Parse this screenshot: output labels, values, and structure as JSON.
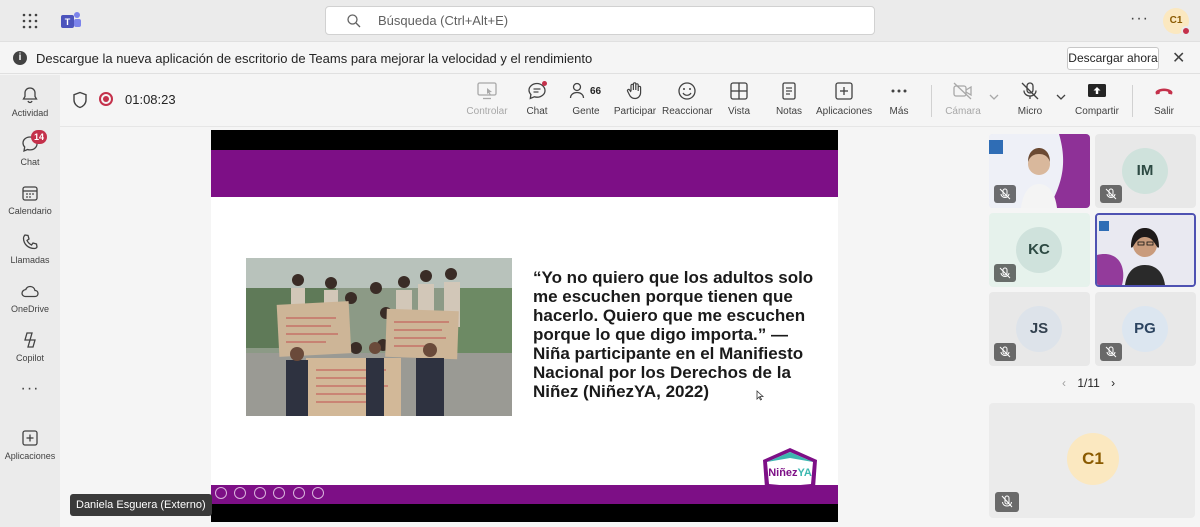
{
  "topbar": {
    "search_placeholder": "Búsqueda (Ctrl+Alt+E)",
    "avatar_initials": "C1"
  },
  "banner": {
    "message": "Descargue la nueva aplicación de escritorio de Teams para mejorar la velocidad y el rendimiento",
    "download_label": "Descargar ahora"
  },
  "rail": {
    "items": [
      {
        "label": "Actividad",
        "icon": "bell-icon"
      },
      {
        "label": "Chat",
        "icon": "chat-icon",
        "badge": "14"
      },
      {
        "label": "Calendario",
        "icon": "calendar-icon"
      },
      {
        "label": "Llamadas",
        "icon": "phone-icon"
      },
      {
        "label": "OneDrive",
        "icon": "cloud-icon"
      },
      {
        "label": "Copilot",
        "icon": "copilot-icon"
      },
      {
        "label": "Aplicaciones",
        "icon": "add-apps-icon"
      }
    ]
  },
  "meeting": {
    "timer": "01:08:23",
    "people_count": "66",
    "toolbar": {
      "controlar": "Controlar",
      "chat": "Chat",
      "gente": "Gente",
      "participar": "Participar",
      "reaccionar": "Reaccionar",
      "vista": "Vista",
      "notas": "Notas",
      "aplicaciones": "Aplicaciones",
      "mas": "Más",
      "camara": "Cámara",
      "micro": "Micro",
      "compartir": "Compartir",
      "salir": "Salir"
    }
  },
  "slide": {
    "quote": "“Yo no quiero que los adultos solo me escuchen porque tienen que hacerlo. Quiero que me escuchen porque lo que digo importa.” — Niña participante en el Manifiesto Nacional por los Derechos de la Niñez (NiñezYA, 2022)",
    "logo_text": "NiñezYA"
  },
  "presenter": {
    "name": "Daniela Esguera (Externo)"
  },
  "participants": [
    {
      "initials": "",
      "type": "video"
    },
    {
      "initials": "IM",
      "type": "avatar"
    },
    {
      "initials": "KC",
      "type": "avatar"
    },
    {
      "initials": "",
      "type": "video"
    },
    {
      "initials": "JS",
      "type": "avatar"
    },
    {
      "initials": "PG",
      "type": "avatar"
    }
  ],
  "pager": {
    "text": "1/11"
  },
  "self": {
    "initials": "C1"
  },
  "colors": {
    "accent": "#4f52b2",
    "leave": "#c4314b",
    "slide_purple": "#7d0f86"
  }
}
